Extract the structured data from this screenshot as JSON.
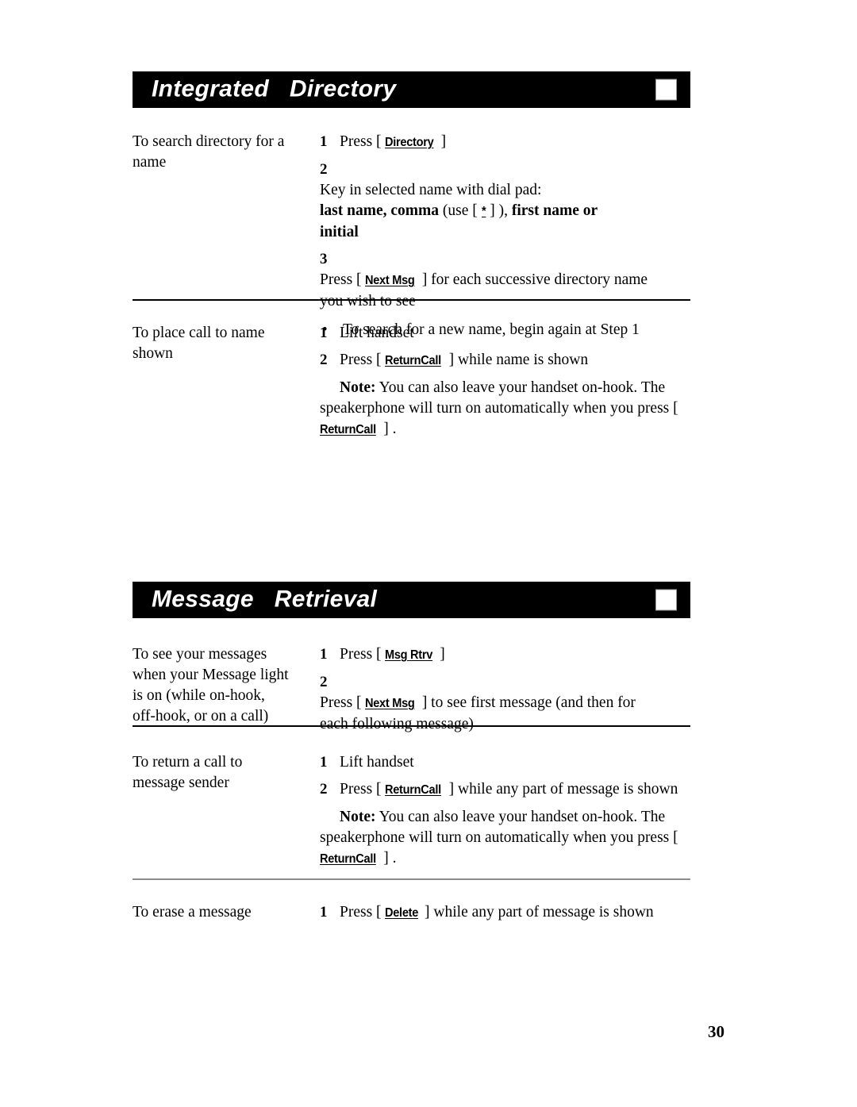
{
  "page": {
    "number": "30"
  },
  "sections": [
    {
      "id": "integrated-directory",
      "title": "Integrated   Directory",
      "blocks": [
        {
          "label_lines": [
            "To search directory for a",
            "name"
          ],
          "steps": [
            {
              "num": "1",
              "prefix": "Press [ ",
              "token": "Directory",
              "suffix": " ]"
            },
            {
              "num": "2",
              "text": "Key in selected name with dial pad:",
              "bold_line_a": "last name, comma ",
              "paren_open": "(use [ ",
              "star": "*",
              "paren_close": " ] ), ",
              "bold_line_b": "first name  or",
              "bold_line_c": "initial"
            },
            {
              "num": "3",
              "prefix": "Press [ ",
              "token": "Next Msg",
              "suffix": " ] for each successive directory name",
              "line2": "you wish to see"
            },
            {
              "bullet": "•",
              "text": "To search for a new name, begin again at Step 1"
            }
          ]
        },
        {
          "label_lines": [
            "To place call to name",
            "shown"
          ],
          "steps": [
            {
              "num": "1",
              "text": "Lift  handset"
            },
            {
              "num": "2",
              "prefix": "Press [ ",
              "token": "ReturnCall",
              "suffix": " ] while name is shown"
            },
            {
              "note_label": "Note:",
              "note_text": " You can also leave your handset on-hook. The speakerphone will turn on automatically when you press [ ",
              "note_token": "ReturnCall",
              "note_suffix": " ] ."
            }
          ]
        }
      ]
    },
    {
      "id": "message-retrieval",
      "title": "Message   Retrieval",
      "blocks": [
        {
          "label_lines": [
            "To see your messages",
            "when your Message light",
            "is on (while on-hook,",
            "off-hook, or on a call)"
          ],
          "steps": [
            {
              "num": "1",
              "prefix": "Press [ ",
              "token": "Msg Rtrv",
              "suffix": " ]"
            },
            {
              "num": "2",
              "prefix": "Press [ ",
              "token": "Next Msg",
              "suffix": " ] to see first message (and then for",
              "line2": "each following message)"
            }
          ]
        },
        {
          "label_lines": [
            "To return a call to",
            "message sender"
          ],
          "steps": [
            {
              "num": "1",
              "text": "Lift handset"
            },
            {
              "num": "2",
              "prefix": "Press [ ",
              "token": "ReturnCall",
              "suffix": " ] while any part of message is shown"
            },
            {
              "note_label": "Note:",
              "note_text": " You can also leave your handset on-hook. The speakerphone will turn on automatically when you press [ ",
              "note_token": "ReturnCall",
              "note_suffix": " ] ."
            }
          ]
        },
        {
          "label_lines": [
            "To erase a message"
          ],
          "steps": [
            {
              "num": "1",
              "prefix": "Press [ ",
              "token": "Delete",
              "suffix": " ] while any part of message is shown"
            }
          ]
        }
      ]
    }
  ],
  "colors": {
    "header_bg": "#000000",
    "header_text": "#ffffff",
    "rule": "#000000",
    "rule_gray": "#8d8d8d"
  }
}
